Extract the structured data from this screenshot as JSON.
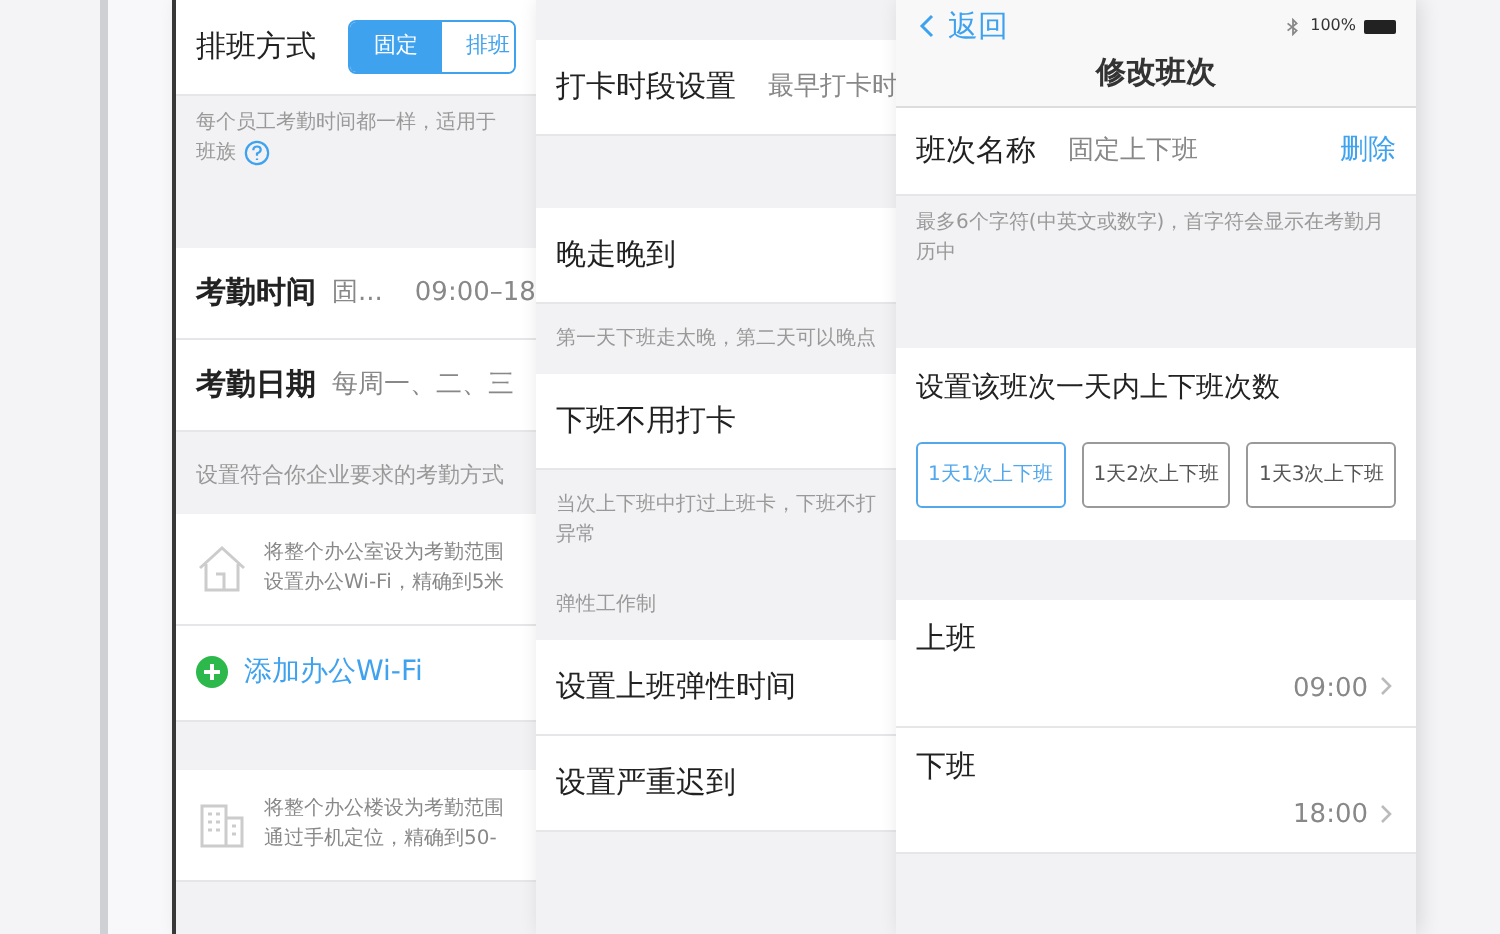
{
  "left_screen": {
    "mode_label": "排班方式",
    "mode_options": [
      {
        "label": "固定",
        "selected": true
      },
      {
        "label": "排班",
        "selected": false
      }
    ],
    "mode_hint": "每个员工考勤时间都一样，适用于",
    "mode_hint_2": "班族",
    "rows": [
      {
        "label": "考勤时间",
        "value": "固...",
        "extra": "09:00–18"
      },
      {
        "label": "考勤日期",
        "value": "每周一、二、三"
      }
    ],
    "section_label": "设置符合你企业要求的考勤方式",
    "methods": [
      {
        "kind": "house",
        "lines": [
          "将整个办公室设为考勤范围",
          "设置办公Wi-Fi，精确到5米"
        ]
      },
      {
        "kind": "add",
        "label": "添加办公Wi-Fi"
      },
      {
        "kind": "building",
        "lines": [
          "将整个办公楼设为考勤范围",
          "通过手机定位，精确到50-"
        ]
      }
    ]
  },
  "middle_screen": {
    "items": [
      {
        "kind": "row",
        "label": "打卡时段设置",
        "value": "最早打卡时"
      },
      {
        "kind": "gap"
      },
      {
        "kind": "row",
        "label": "晚走晚到"
      },
      {
        "kind": "hint",
        "text": "第一天下班走太晚，第二天可以晚点"
      },
      {
        "kind": "row",
        "label": "下班不用打卡"
      },
      {
        "kind": "hint",
        "text": "当次上下班中打过上班卡，下班不打",
        "text_2": "异常"
      },
      {
        "kind": "hint",
        "text": "弹性工作制"
      },
      {
        "kind": "row",
        "label": "设置上班弹性时间"
      },
      {
        "kind": "row",
        "label": "设置严重迟到"
      }
    ]
  },
  "right_screen": {
    "back": "返回",
    "battery": "100%",
    "title": "修改班次",
    "delete": "删除",
    "name_label": "班次名称",
    "name_value": "固定上下班",
    "name_hint": "最多6个字符(中英文或数字)，首字符会显示在考勤月历中",
    "count_label": "设置该班次一天内上下班次数",
    "count_options": [
      {
        "label": "1天1次上下班",
        "selected": true
      },
      {
        "label": "1天2次上下班",
        "selected": false
      },
      {
        "label": "1天3次上下班",
        "selected": false
      }
    ],
    "times": [
      {
        "label": "上班",
        "value": "09:00"
      },
      {
        "label": "下班",
        "value": "18:00"
      }
    ]
  }
}
